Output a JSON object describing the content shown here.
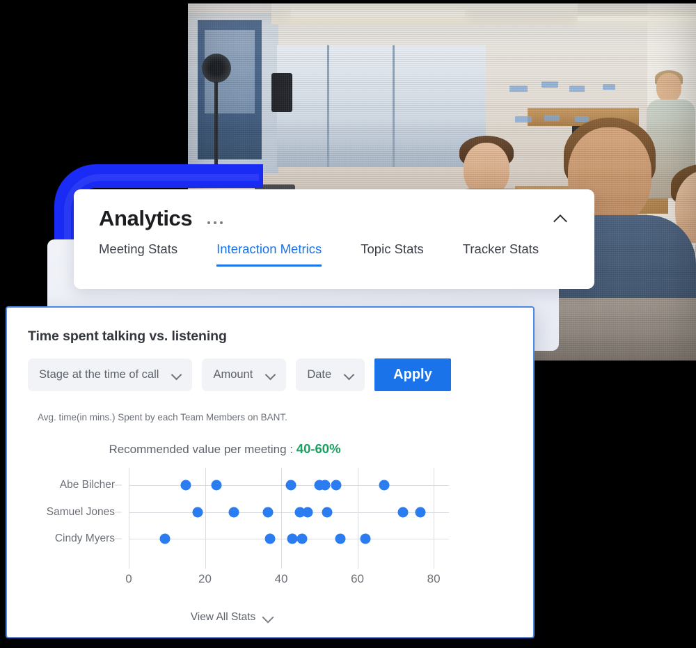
{
  "photo": {
    "alt_name": "office-team-meeting-photo"
  },
  "analytics": {
    "title": "Analytics",
    "more_icon": "ellipsis-icon",
    "collapse_icon": "chevron-up-icon",
    "tabs": [
      {
        "label": "Meeting Stats",
        "active": false
      },
      {
        "label": "Interaction Metrics",
        "active": true
      },
      {
        "label": "Topic Stats",
        "active": false
      },
      {
        "label": "Tracker Stats",
        "active": false
      }
    ],
    "accent_color": "#1a73e8"
  },
  "chart_card": {
    "title": "Time spent talking vs. listening",
    "filters": [
      {
        "label": "Stage at the time of call",
        "icon": "chevron-down-icon"
      },
      {
        "label": "Amount",
        "icon": "chevron-down-icon"
      },
      {
        "label": "Date",
        "icon": "chevron-down-icon"
      }
    ],
    "apply_label": "Apply",
    "apply_color": "#1a73e8",
    "subtitle": "Avg. time(in mins.) Spent by each Team Members on BANT.",
    "recommended_label": "Recommended value per meeting :",
    "recommended_value": "40-60%",
    "recommended_color": "#1aa260",
    "view_all_label": "View All Stats",
    "view_all_icon": "chevron-down-icon"
  },
  "chart_data": {
    "type": "scatter",
    "title": "Time spent talking vs. listening",
    "subtitle": "Avg. time(in mins.) Spent by each Team Members on BANT.",
    "xlabel": "",
    "ylabel": "",
    "xlim": [
      0,
      84
    ],
    "ylim_categories": [
      "Abe Bilcher",
      "Samuel Jones",
      "Cindy Myers"
    ],
    "xticks": [
      0,
      20,
      40,
      60,
      80
    ],
    "grid": true,
    "legend": "none",
    "point_color": "#2b7cf0",
    "annotation": "Recommended value per meeting : 40-60%",
    "series": [
      {
        "name": "Abe Bilcher",
        "values": [
          15,
          23,
          42.5,
          50,
          51.5,
          54.5,
          67
        ]
      },
      {
        "name": "Samuel Jones",
        "values": [
          18,
          27.5,
          36.5,
          45,
          47,
          52,
          72,
          76.5
        ]
      },
      {
        "name": "Cindy Myers",
        "values": [
          9.5,
          37,
          43,
          45.5,
          55.5,
          62
        ]
      }
    ]
  }
}
